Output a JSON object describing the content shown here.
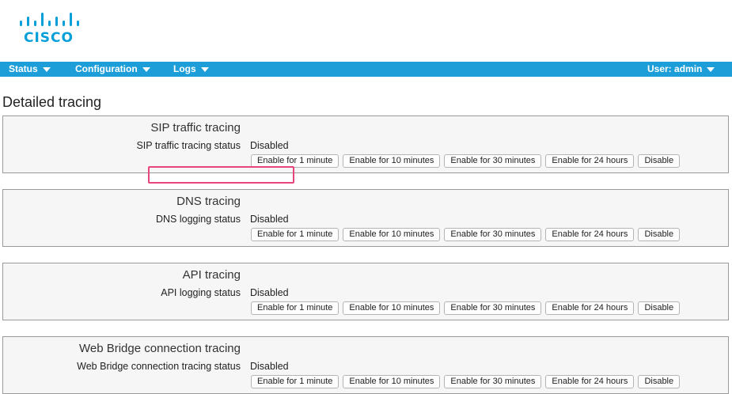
{
  "brand": {
    "logo_text": "CISCO",
    "color": "#049fd9"
  },
  "nav": {
    "status": "Status",
    "configuration": "Configuration",
    "logs": "Logs",
    "user": "User: admin",
    "background": "#1d9ed8"
  },
  "page_title": "Detailed tracing",
  "sections": [
    {
      "title": "SIP traffic tracing",
      "status_label": "SIP traffic tracing status",
      "status_value": "Disabled"
    },
    {
      "title": "DNS tracing",
      "status_label": "DNS logging status",
      "status_value": "Disabled"
    },
    {
      "title": "API tracing",
      "status_label": "API logging status",
      "status_value": "Disabled"
    },
    {
      "title": "Web Bridge connection tracing",
      "status_label": "Web Bridge connection tracing status",
      "status_value": "Disabled"
    }
  ],
  "buttons": {
    "enable_1": "Enable for 1 minute",
    "enable_10": "Enable for 10 minutes",
    "enable_30": "Enable for 30 minutes",
    "enable_24h": "Enable for 24 hours",
    "disable": "Disable"
  },
  "highlight_color": "#e8457a"
}
